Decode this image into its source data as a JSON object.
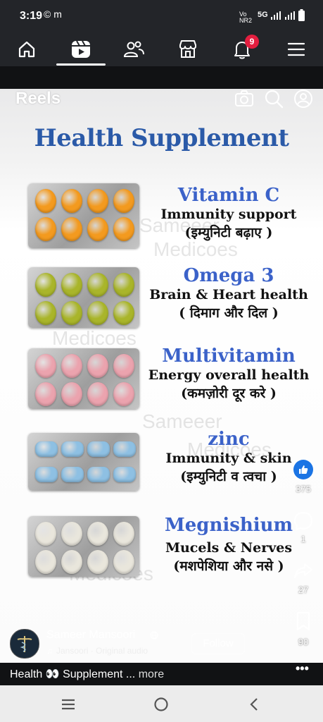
{
  "status_bar": {
    "time": "3:19",
    "network": "5G",
    "left_icons": "© m",
    "right_icons": "Vo NR2 5G"
  },
  "top_nav": {
    "items": [
      "home-icon",
      "reels-icon",
      "friends-icon",
      "marketplace-icon",
      "notifications-icon",
      "menu-icon"
    ],
    "notification_count": "9"
  },
  "reel": {
    "title": "Reels",
    "headline": "Health Supplement",
    "watermarks": [
      "Sameeer",
      "Medicoes",
      "Medicoes",
      "Sameeer",
      "Medicoes",
      "Medicoes"
    ],
    "supplements": [
      {
        "name": "Vitamin C",
        "desc": "Immunity support",
        "hindi": "(इम्युनिटी बढ़ाए )",
        "pill_color": "#f39a1f"
      },
      {
        "name": "Omega 3",
        "desc": "Brain & Heart health",
        "hindi": "( दिमाग और दिल )",
        "pill_color": "#a9b52a"
      },
      {
        "name": "Multivitamin",
        "desc": "Energy overall health",
        "hindi": "(कमज़ोरी दूर करे )",
        "pill_color": "#eba3ae"
      },
      {
        "name": "zinc",
        "desc": "Immunity & skin",
        "hindi": "(इम्युनिटी व त्वचा )",
        "pill_color": "#8ec0e3"
      },
      {
        "name": "Megnishium",
        "desc": "Mucels & Nerves",
        "hindi": "(मशपेशिया और नसे )",
        "pill_color": "#e9e6dc"
      }
    ]
  },
  "actions": {
    "likes": "375",
    "comments": "1",
    "shares": "27",
    "saves": "90"
  },
  "author": {
    "name": "Sameer Mansoori",
    "audio": "Jansoori · Original audio",
    "follow_label": "Follow"
  },
  "caption": {
    "text": "Health 👀 Supplement ...",
    "more": "more"
  },
  "colors": {
    "brand_blue": "#1b74e4",
    "badge_red": "#e41e3f",
    "headline_blue": "#2b5aa8"
  }
}
